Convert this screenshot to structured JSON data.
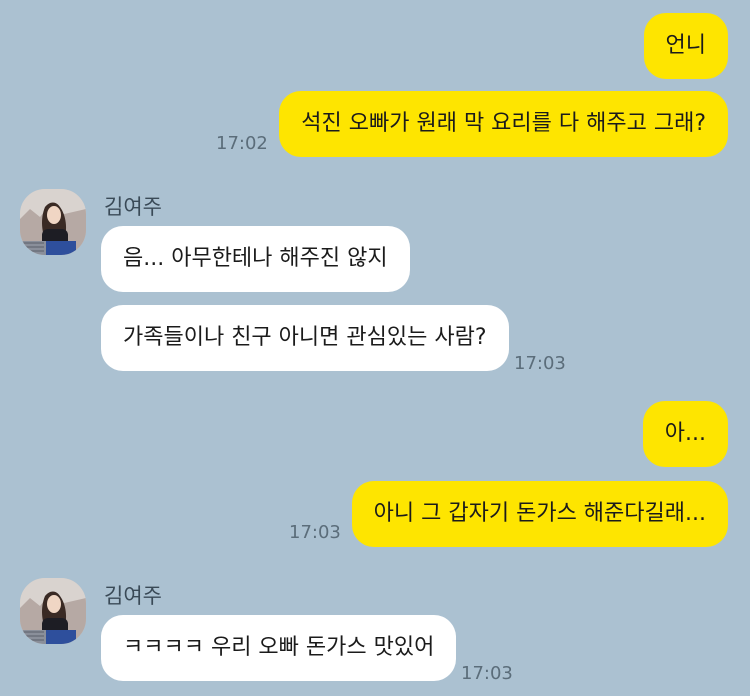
{
  "chat": {
    "messages": [
      {
        "from": "me",
        "text": "언니"
      },
      {
        "from": "me",
        "text": "석진 오빠가 원래 막 요리를 다 해주고 그래?",
        "time": "17:02"
      },
      {
        "from": "other",
        "sender": "김여주",
        "text": "음... 아무한테나 해주진 않지"
      },
      {
        "from": "other",
        "text": "가족들이나 친구 아니면 관심있는 사람?",
        "time": "17:03"
      },
      {
        "from": "me",
        "text": "아..."
      },
      {
        "from": "me",
        "text": "아니 그 갑자기 돈가스 해준다길래...",
        "time": "17:03"
      },
      {
        "from": "other",
        "sender": "김여주",
        "text": "ㅋㅋㅋㅋ 우리 오빠 돈가스 맛있어",
        "time": "17:03"
      }
    ]
  },
  "colors": {
    "background": "#abc1d1",
    "my_bubble": "#fee500",
    "other_bubble": "#ffffff"
  },
  "icons": {
    "avatar": "profile-photo"
  }
}
